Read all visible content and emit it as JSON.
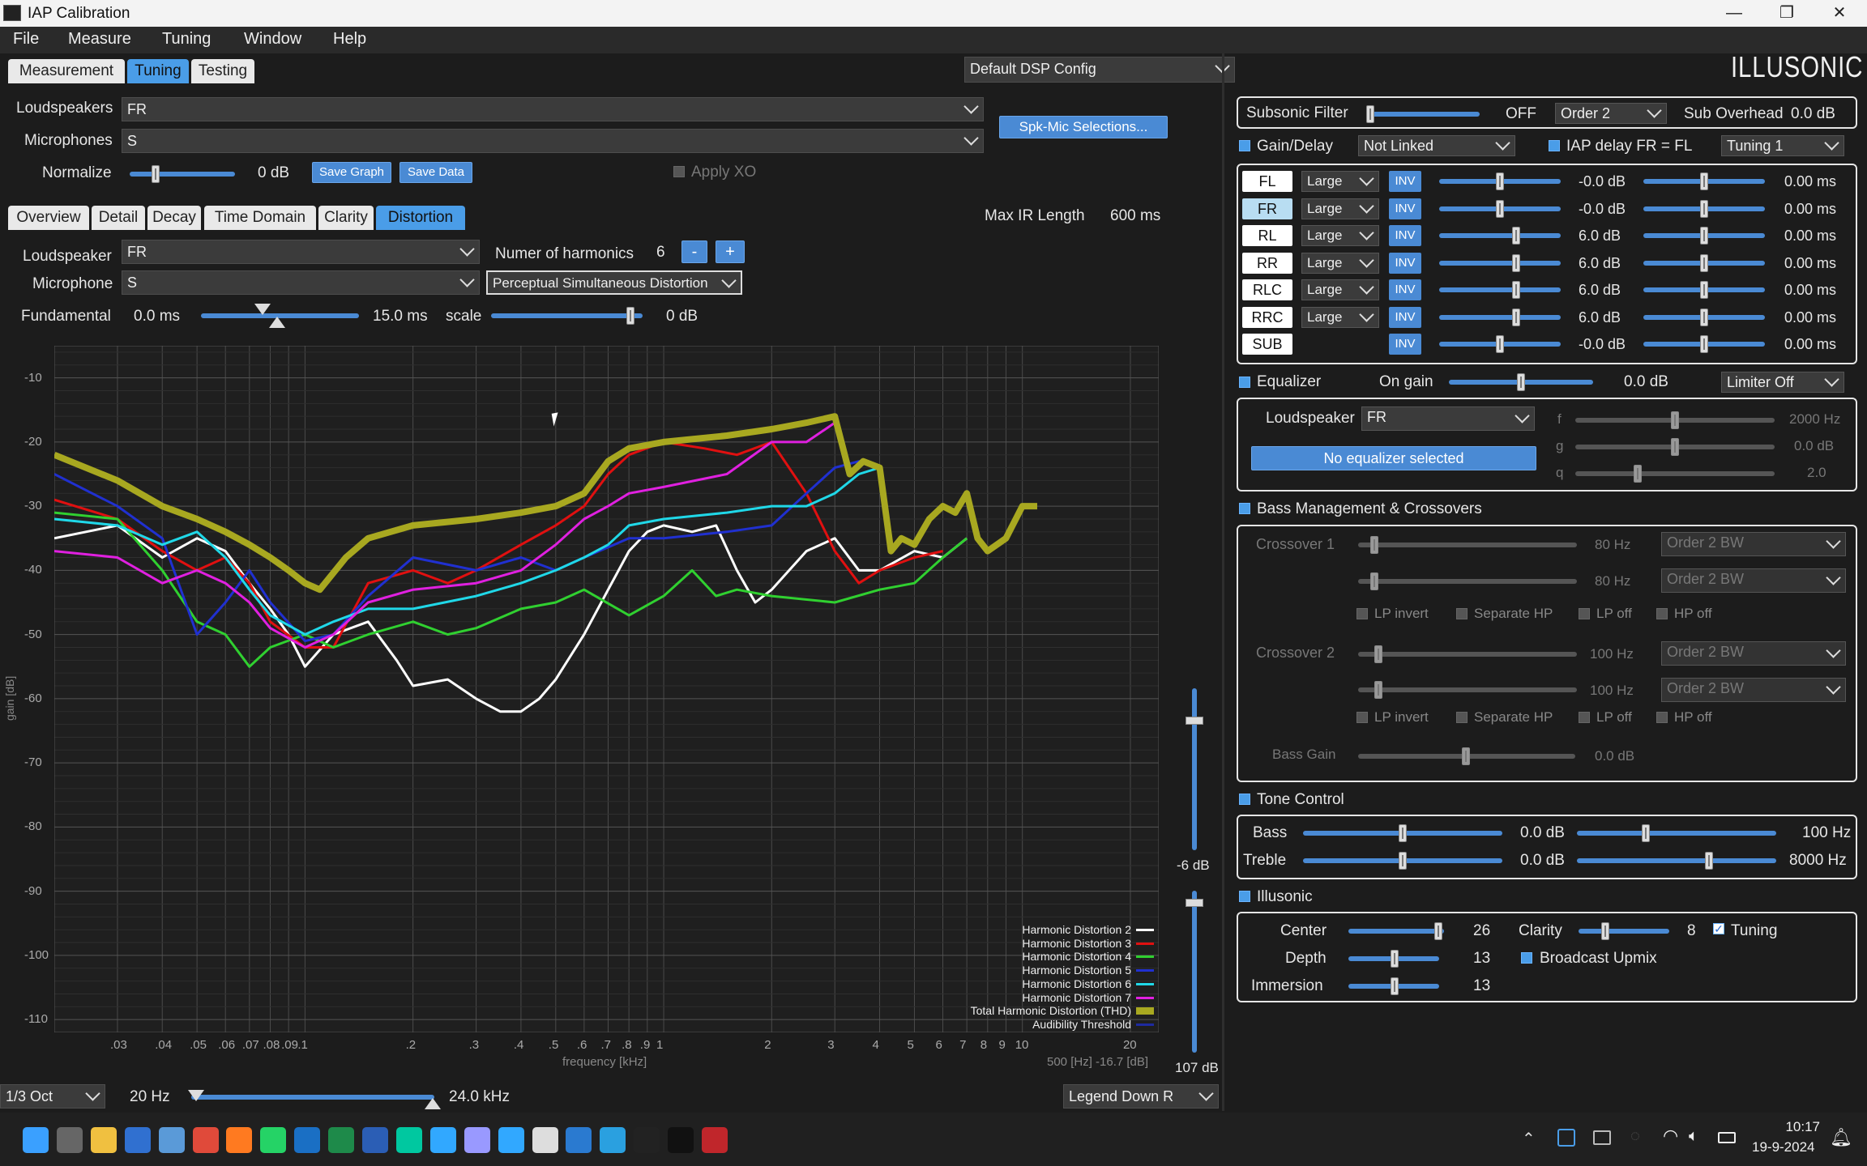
{
  "window": {
    "title": "IAP Calibration",
    "min": "—",
    "max": "❐",
    "close": "✕"
  },
  "menu": [
    "File",
    "Measure",
    "Tuning",
    "Window",
    "Help"
  ],
  "top_tabs": [
    "Measurement",
    "Tuning",
    "Testing"
  ],
  "dsp_config": "Default DSP Config",
  "brand": "ILLUSONIC",
  "sel": {
    "loudspeakers_label": "Loudspeakers",
    "loudspeakers": "FR",
    "microphones_label": "Microphones",
    "microphones": "S",
    "spk_btn": "Spk-Mic Selections...",
    "normalize_label": "Normalize",
    "normalize_val": "0 dB",
    "save_graph": "Save Graph",
    "save_data": "Save Data",
    "apply_xo": "Apply XO"
  },
  "sub_tabs": [
    "Overview",
    "Detail",
    "Decay",
    "Time Domain",
    "Clarity",
    "Distortion"
  ],
  "max_ir": {
    "label": "Max IR Length",
    "value": "600 ms"
  },
  "dist": {
    "loudspeaker_label": "Loudspeaker",
    "loudspeaker": "FR",
    "microphone_label": "Microphone",
    "microphone": "S",
    "harm_label": "Numer of harmonics",
    "harm": "6",
    "minus": "-",
    "plus": "+",
    "mode": "Perceptual Simultaneous Distortion",
    "fund_label": "Fundamental",
    "fund_min": "0.0 ms",
    "fund_max": "15.0 ms",
    "scale_label": "scale",
    "scale_val": "0 dB"
  },
  "chart_data": {
    "type": "line",
    "xlabel": "frequency [kHz]",
    "ylabel": "gain [dB]",
    "x_ticks": [
      ".03",
      ".04",
      ".05",
      ".06",
      ".07",
      ".08",
      ".09",
      ".1",
      ".2",
      ".3",
      ".4",
      ".5",
      ".6",
      ".7",
      ".8",
      ".9",
      "1",
      "2",
      "3",
      "4",
      "5",
      "6",
      "7",
      "8",
      "9",
      "10",
      "20"
    ],
    "y_ticks": [
      "-10",
      "-20",
      "-30",
      "-40",
      "-50",
      "-60",
      "-70",
      "-80",
      "-90",
      "-100",
      "-110"
    ],
    "ylim": [
      -112,
      -5
    ],
    "xlim_khz": [
      0.02,
      24
    ],
    "cursor_readout": "500 [Hz] -16.7 [dB]",
    "legend_position": "bottom-right",
    "series": [
      {
        "name": "Harmonic Distortion 2",
        "color": "#ffffff",
        "width": 3,
        "points": [
          [
            0.02,
            -35
          ],
          [
            0.03,
            -33
          ],
          [
            0.04,
            -38
          ],
          [
            0.05,
            -35
          ],
          [
            0.06,
            -37
          ],
          [
            0.07,
            -42
          ],
          [
            0.08,
            -46
          ],
          [
            0.09,
            -50
          ],
          [
            0.1,
            -55
          ],
          [
            0.12,
            -50
          ],
          [
            0.15,
            -48
          ],
          [
            0.18,
            -54
          ],
          [
            0.2,
            -58
          ],
          [
            0.25,
            -57
          ],
          [
            0.3,
            -60
          ],
          [
            0.35,
            -62
          ],
          [
            0.4,
            -62
          ],
          [
            0.45,
            -60
          ],
          [
            0.5,
            -57
          ],
          [
            0.6,
            -50
          ],
          [
            0.7,
            -43
          ],
          [
            0.8,
            -37
          ],
          [
            0.9,
            -34
          ],
          [
            1,
            -33
          ],
          [
            1.2,
            -34
          ],
          [
            1.4,
            -33
          ],
          [
            1.6,
            -40
          ],
          [
            1.8,
            -45
          ],
          [
            2,
            -43
          ],
          [
            2.5,
            -37
          ],
          [
            3,
            -35
          ],
          [
            3.5,
            -40
          ],
          [
            4,
            -40
          ],
          [
            5,
            -37
          ],
          [
            6,
            -38
          ],
          [
            7,
            -35
          ]
        ]
      },
      {
        "name": "Harmonic Distortion 3",
        "color": "#e01010",
        "width": 3,
        "points": [
          [
            0.02,
            -29
          ],
          [
            0.03,
            -32
          ],
          [
            0.04,
            -37
          ],
          [
            0.05,
            -40
          ],
          [
            0.06,
            -38
          ],
          [
            0.07,
            -42
          ],
          [
            0.08,
            -48
          ],
          [
            0.1,
            -52
          ],
          [
            0.12,
            -52
          ],
          [
            0.15,
            -42
          ],
          [
            0.2,
            -40
          ],
          [
            0.25,
            -42
          ],
          [
            0.3,
            -40
          ],
          [
            0.4,
            -36
          ],
          [
            0.5,
            -33
          ],
          [
            0.6,
            -30
          ],
          [
            0.7,
            -25
          ],
          [
            0.8,
            -22
          ],
          [
            1,
            -20
          ],
          [
            1.3,
            -21
          ],
          [
            1.6,
            -22
          ],
          [
            2,
            -20
          ],
          [
            2.5,
            -28
          ],
          [
            3,
            -37
          ],
          [
            3.5,
            -42
          ],
          [
            4,
            -40
          ],
          [
            5,
            -38
          ],
          [
            6,
            -37
          ]
        ]
      },
      {
        "name": "Harmonic Distortion 4",
        "color": "#30d030",
        "width": 3,
        "points": [
          [
            0.02,
            -31
          ],
          [
            0.03,
            -32
          ],
          [
            0.04,
            -40
          ],
          [
            0.05,
            -48
          ],
          [
            0.06,
            -50
          ],
          [
            0.07,
            -55
          ],
          [
            0.08,
            -52
          ],
          [
            0.1,
            -50
          ],
          [
            0.12,
            -52
          ],
          [
            0.15,
            -50
          ],
          [
            0.2,
            -48
          ],
          [
            0.25,
            -50
          ],
          [
            0.3,
            -49
          ],
          [
            0.4,
            -46
          ],
          [
            0.5,
            -45
          ],
          [
            0.6,
            -43
          ],
          [
            0.8,
            -47
          ],
          [
            1,
            -44
          ],
          [
            1.2,
            -40
          ],
          [
            1.4,
            -44
          ],
          [
            1.6,
            -43
          ],
          [
            2,
            -44
          ],
          [
            3,
            -45
          ],
          [
            4,
            -43
          ],
          [
            5,
            -42
          ],
          [
            6,
            -38
          ],
          [
            7,
            -35
          ]
        ]
      },
      {
        "name": "Harmonic Distortion 5",
        "color": "#2030d0",
        "width": 3,
        "points": [
          [
            0.02,
            -25
          ],
          [
            0.03,
            -30
          ],
          [
            0.04,
            -35
          ],
          [
            0.05,
            -50
          ],
          [
            0.06,
            -45
          ],
          [
            0.07,
            -40
          ],
          [
            0.08,
            -45
          ],
          [
            0.1,
            -51
          ],
          [
            0.12,
            -50
          ],
          [
            0.15,
            -44
          ],
          [
            0.2,
            -38
          ],
          [
            0.3,
            -40
          ],
          [
            0.4,
            -38
          ],
          [
            0.5,
            -40
          ],
          [
            0.6,
            -38
          ],
          [
            0.8,
            -35
          ],
          [
            1,
            -35
          ],
          [
            1.5,
            -34
          ],
          [
            2,
            -33
          ],
          [
            2.5,
            -28
          ],
          [
            3,
            -24
          ],
          [
            3.5,
            -23
          ],
          [
            4,
            -24
          ]
        ]
      },
      {
        "name": "Harmonic Distortion 6",
        "color": "#20d8e8",
        "width": 3,
        "points": [
          [
            0.02,
            -32
          ],
          [
            0.03,
            -33
          ],
          [
            0.04,
            -36
          ],
          [
            0.05,
            -34
          ],
          [
            0.06,
            -38
          ],
          [
            0.07,
            -43
          ],
          [
            0.08,
            -47
          ],
          [
            0.1,
            -50
          ],
          [
            0.12,
            -48
          ],
          [
            0.15,
            -46
          ],
          [
            0.2,
            -46
          ],
          [
            0.3,
            -44
          ],
          [
            0.4,
            -42
          ],
          [
            0.5,
            -40
          ],
          [
            0.6,
            -38
          ],
          [
            0.7,
            -36
          ],
          [
            0.8,
            -33
          ],
          [
            1,
            -32
          ],
          [
            1.5,
            -31
          ],
          [
            2,
            -30
          ],
          [
            2.5,
            -30
          ],
          [
            3,
            -28
          ],
          [
            3.5,
            -25
          ],
          [
            4,
            -24
          ]
        ]
      },
      {
        "name": "Harmonic Distortion 7",
        "color": "#e020e0",
        "width": 3,
        "points": [
          [
            0.02,
            -37
          ],
          [
            0.03,
            -38
          ],
          [
            0.04,
            -42
          ],
          [
            0.05,
            -40
          ],
          [
            0.06,
            -42
          ],
          [
            0.07,
            -45
          ],
          [
            0.08,
            -49
          ],
          [
            0.1,
            -52
          ],
          [
            0.12,
            -50
          ],
          [
            0.15,
            -45
          ],
          [
            0.2,
            -43
          ],
          [
            0.3,
            -42
          ],
          [
            0.4,
            -40
          ],
          [
            0.5,
            -36
          ],
          [
            0.6,
            -32
          ],
          [
            0.7,
            -30
          ],
          [
            0.8,
            -28
          ],
          [
            1,
            -27
          ],
          [
            1.5,
            -25
          ],
          [
            2,
            -20
          ],
          [
            2.5,
            -20
          ],
          [
            3,
            -17
          ]
        ]
      },
      {
        "name": "Total Harmonic Distortion (THD)",
        "color": "#a8a820",
        "width": 8,
        "points": [
          [
            0.02,
            -22
          ],
          [
            0.03,
            -26
          ],
          [
            0.04,
            -30
          ],
          [
            0.05,
            -32
          ],
          [
            0.06,
            -34
          ],
          [
            0.07,
            -36
          ],
          [
            0.08,
            -38
          ],
          [
            0.09,
            -40
          ],
          [
            0.1,
            -42
          ],
          [
            0.11,
            -43
          ],
          [
            0.13,
            -38
          ],
          [
            0.15,
            -35
          ],
          [
            0.2,
            -33
          ],
          [
            0.3,
            -32
          ],
          [
            0.4,
            -31
          ],
          [
            0.5,
            -30
          ],
          [
            0.6,
            -28
          ],
          [
            0.7,
            -23
          ],
          [
            0.8,
            -21
          ],
          [
            1,
            -20
          ],
          [
            1.5,
            -19
          ],
          [
            2,
            -18
          ],
          [
            2.5,
            -17
          ],
          [
            3,
            -16
          ],
          [
            3.3,
            -25
          ],
          [
            3.6,
            -23
          ],
          [
            4,
            -24
          ],
          [
            4.3,
            -37
          ],
          [
            4.6,
            -35
          ],
          [
            5,
            -36
          ],
          [
            5.5,
            -32
          ],
          [
            6,
            -30
          ],
          [
            6.5,
            -31
          ],
          [
            7,
            -28
          ],
          [
            7.5,
            -35
          ],
          [
            8,
            -37
          ],
          [
            9,
            -35
          ],
          [
            10,
            -30
          ],
          [
            11,
            -30
          ]
        ]
      },
      {
        "name": "Audibility Threshold",
        "color": "#1e2aa0",
        "width": 3,
        "points": []
      }
    ]
  },
  "bottom": {
    "octave": "1/3 Oct",
    "fmin": "20 Hz",
    "fmax": "24.0 kHz",
    "legend": "Legend Down R",
    "vs1_val": "-6 dB",
    "vs2_val": "107 dB"
  },
  "right": {
    "subsonic_label": "Subsonic Filter",
    "subsonic_state": "OFF",
    "subsonic_order": "Order 2",
    "sub_overhead": "Sub Overhead",
    "sub_overhead_val": "0.0 dB",
    "gain_label": "Gain/Delay",
    "linked": "Not Linked",
    "iap_delay": "IAP delay FR = FL",
    "tuning": "Tuning 1",
    "channels": [
      {
        "name": "FL",
        "size": "Large",
        "inv": "INV",
        "gain": "-0.0 dB",
        "delay": "0.00 ms",
        "g": 0.5,
        "d": 0.5
      },
      {
        "name": "FR",
        "size": "Large",
        "inv": "INV",
        "gain": "-0.0 dB",
        "delay": "0.00 ms",
        "g": 0.5,
        "d": 0.5
      },
      {
        "name": "RL",
        "size": "Large",
        "inv": "INV",
        "gain": "6.0 dB",
        "delay": "0.00 ms",
        "g": 0.64,
        "d": 0.5
      },
      {
        "name": "RR",
        "size": "Large",
        "inv": "INV",
        "gain": "6.0 dB",
        "delay": "0.00 ms",
        "g": 0.64,
        "d": 0.5
      },
      {
        "name": "RLC",
        "size": "Large",
        "inv": "INV",
        "gain": "6.0 dB",
        "delay": "0.00 ms",
        "g": 0.64,
        "d": 0.5
      },
      {
        "name": "RRC",
        "size": "Large",
        "inv": "INV",
        "gain": "6.0 dB",
        "delay": "0.00 ms",
        "g": 0.64,
        "d": 0.5
      },
      {
        "name": "SUB",
        "size": "",
        "inv": "INV",
        "gain": "-0.0 dB",
        "delay": "0.00 ms",
        "g": 0.5,
        "d": 0.5
      }
    ],
    "eq_label": "Equalizer",
    "on_gain": "On gain",
    "on_gain_val": "0.0 dB",
    "limiter": "Limiter Off",
    "eq_ls_label": "Loudspeaker",
    "eq_ls": "FR",
    "no_eq": "No equalizer selected",
    "eq_f": "f",
    "eq_f_val": "2000 Hz",
    "eq_g": "g",
    "eq_g_val": "0.0 dB",
    "eq_q": "q",
    "eq_q_val": "2.0",
    "bass_label": "Bass Management & Crossovers",
    "xo1": "Crossover 1",
    "xo1_a": "80 Hz",
    "xo1_b": "80 Hz",
    "xo2": "Crossover 2",
    "xo2_a": "100 Hz",
    "xo2_b": "100 Hz",
    "order_bw": "Order 2 BW",
    "lp_invert": "LP invert",
    "sep_hp": "Separate HP",
    "lp_off": "LP off",
    "hp_off": "HP off",
    "bass_gain": "Bass Gain",
    "bass_gain_val": "0.0 dB",
    "tone_label": "Tone Control",
    "bass": "Bass",
    "bass_val": "0.0 dB",
    "bass_f": "100 Hz",
    "treble": "Treble",
    "treble_val": "0.0 dB",
    "treble_f": "8000 Hz",
    "ill_label": "Illusonic",
    "center": "Center",
    "center_val": "26",
    "depth": "Depth",
    "depth_val": "13",
    "immersion": "Immersion",
    "immersion_val": "13",
    "clarity": "Clarity",
    "clarity_val": "8",
    "tuning_chk": "Tuning",
    "broadcast": "Broadcast Upmix"
  },
  "taskbar": {
    "time": "10:17",
    "date": "19-9-2024",
    "icons": [
      "start-icon",
      "file-explorer-icon",
      "folder-icon",
      "store-icon",
      "calendar-icon",
      "chrome-icon",
      "firefox-icon",
      "whatsapp-icon",
      "outlook-icon",
      "excel-icon",
      "word-icon",
      "audition-icon",
      "photoshop-icon",
      "premiere-icon",
      "lightroom-icon",
      "roon-icon",
      "circle-app-icon",
      "search-app-icon",
      "illusonic-icon",
      "id-app-icon",
      "red-app-icon"
    ]
  }
}
